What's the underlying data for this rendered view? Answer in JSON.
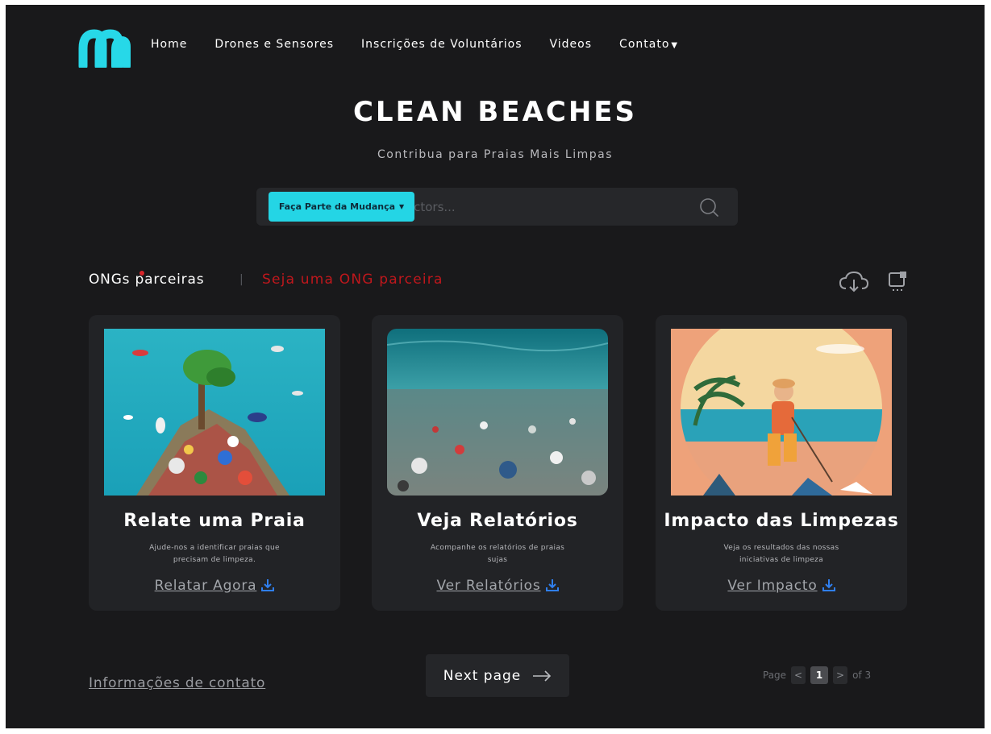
{
  "nav": {
    "items": [
      {
        "label": "Home"
      },
      {
        "label": "Drones e Sensores"
      },
      {
        "label": "Inscrições de Voluntários"
      },
      {
        "label": "Videos"
      },
      {
        "label": "Contato"
      }
    ]
  },
  "hero": {
    "title": "CLEAN BEACHES",
    "subtitle": "Contribua para Praias Mais Limpas",
    "cta_label": "Faça Parte da Mudança",
    "search_placeholder": "vectors..."
  },
  "partners": {
    "label": "ONGs parceiras",
    "separator": "|",
    "link": "Seja uma ONG parceira"
  },
  "cards": [
    {
      "title": "Relate uma Praia",
      "desc": "Ajude-nos a identificar praias que precisam de limpeza.",
      "link": "Relatar Agora"
    },
    {
      "title": "Veja Relatórios",
      "desc": "Acompanhe os relatórios de praias sujas",
      "link": "Ver Relatórios"
    },
    {
      "title": "Impacto das Limpezas",
      "desc": "Veja os resultados das nossas iniciativas de limpeza",
      "link": "Ver Impacto"
    }
  ],
  "footer": {
    "contact": "Informações de contato",
    "next": "Next page",
    "pager_prefix": "Page",
    "prev_symbol": "<",
    "current_page": "1",
    "next_symbol": ">",
    "pager_suffix": "of 3"
  },
  "colors": {
    "accent": "#24d5e5",
    "background": "#19191b",
    "card": "#222326",
    "link_red": "#c0171c",
    "download_blue": "#2f7ff0"
  }
}
